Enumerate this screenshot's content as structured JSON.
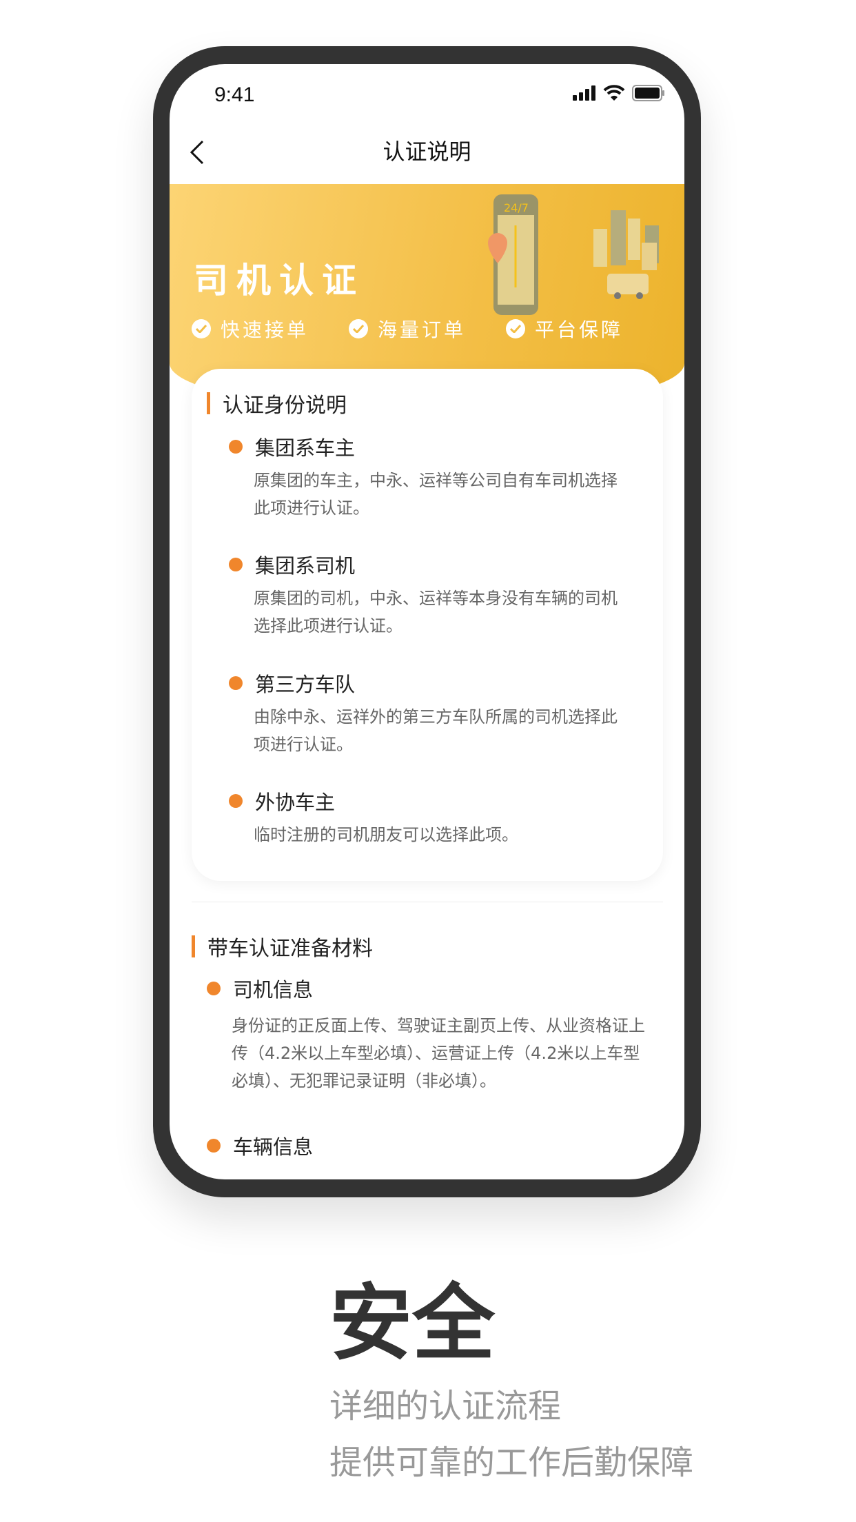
{
  "status_bar": {
    "time": "9:41",
    "icons": [
      "signal-icon",
      "wifi-icon",
      "battery-icon"
    ]
  },
  "nav": {
    "title": "认证说明",
    "back_icon": "chevron-left-icon"
  },
  "banner": {
    "title": "司机认证",
    "features": [
      "快速接单",
      "海量订单",
      "平台保障"
    ],
    "colors": {
      "start": "#fcd474",
      "end": "#ecb32c"
    }
  },
  "identity_section": {
    "title": "认证身份说明",
    "items": [
      {
        "title": "集团系车主",
        "desc": "原集团的车主，中永、运祥等公司自有车司机选择此项进行认证。"
      },
      {
        "title": "集团系司机",
        "desc": "原集团的司机，中永、运祥等本身没有车辆的司机选择此项进行认证。"
      },
      {
        "title": "第三方车队",
        "desc": "由除中永、运祥外的第三方车队所属的司机选择此项进行认证。"
      },
      {
        "title": "外协车主",
        "desc": "临时注册的司机朋友可以选择此项。"
      }
    ]
  },
  "materials_section": {
    "title": "带车认证准备材料",
    "items": [
      {
        "title": "司机信息",
        "desc": "身份证的正反面上传、驾驶证主副页上传、从业资格证上传（4.2米以上车型必填）、运营证上传（4.2米以上车型必填）、无犯罪记录证明（非必填）。"
      },
      {
        "title": "车辆信息"
      }
    ]
  },
  "promo": {
    "headline": "安全",
    "lines": [
      "详细的认证流程",
      "提供可靠的工作后勤保障"
    ]
  },
  "accent_color": "#f0862c"
}
